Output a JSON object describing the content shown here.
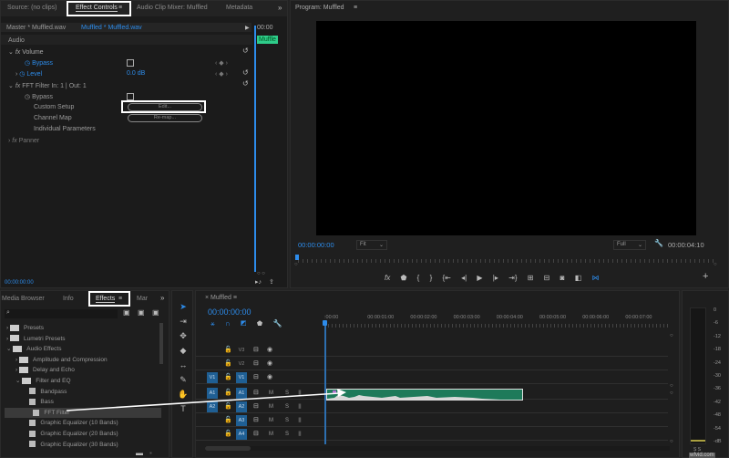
{
  "effect_controls": {
    "tabs": [
      "Source: (no clips)",
      "Effect Controls",
      "Audio Clip Mixer: Muffled",
      "Metadata"
    ],
    "active_tab": "Effect Controls",
    "master": "Master * Muffled.wav",
    "clip": "Muffled * Muffled.wav",
    "mini_timecode": "00:00",
    "mini_clip": "Muffle",
    "section": "Audio",
    "volume": "Volume",
    "bypass": "Bypass",
    "level": "Level",
    "level_value": "0.0",
    "level_unit": "dB",
    "fft": "FFT Filter  In: 1 | Out: 1",
    "custom_setup": "Custom Setup",
    "edit_btn": "Edit...",
    "channel_map": "Channel Map",
    "remap_btn": "Re-map...",
    "individual": "Individual Parameters",
    "panner": "Panner",
    "timecode": "00:00:00:00"
  },
  "program": {
    "title": "Program: Muffled",
    "timecode": "00:00:00:00",
    "fit": "Fit",
    "quality": "Full",
    "duration": "00:00:04:10"
  },
  "effects": {
    "tabs": [
      "Media Browser",
      "Info",
      "Effects",
      "Mar"
    ],
    "active_tab": "Effects",
    "items": [
      {
        "label": "Presets",
        "level": 0,
        "type": "folder-preset",
        "open": false
      },
      {
        "label": "Lumetri Presets",
        "level": 0,
        "type": "folder-preset",
        "open": false
      },
      {
        "label": "Audio Effects",
        "level": 0,
        "type": "folder",
        "open": true
      },
      {
        "label": "Amplitude and Compression",
        "level": 1,
        "type": "folder",
        "open": false
      },
      {
        "label": "Delay and Echo",
        "level": 1,
        "type": "folder",
        "open": false
      },
      {
        "label": "Filter and EQ",
        "level": 1,
        "type": "folder",
        "open": true
      },
      {
        "label": "Bandpass",
        "level": 2,
        "type": "fx"
      },
      {
        "label": "Bass",
        "level": 2,
        "type": "fx"
      },
      {
        "label": "FFT Filter",
        "level": 2,
        "type": "fx",
        "selected": true
      },
      {
        "label": "Graphic Equalizer (10 Bands)",
        "level": 2,
        "type": "fx"
      },
      {
        "label": "Graphic Equalizer (20 Bands)",
        "level": 2,
        "type": "fx"
      },
      {
        "label": "Graphic Equalizer (30 Bands)",
        "level": 2,
        "type": "fx"
      }
    ]
  },
  "timeline": {
    "title": "Muffled",
    "timecode": "00:00:00:00",
    "ruler": [
      ":00:00",
      "00:00:01:00",
      "00:00:02:00",
      "00:00:03:00",
      "00:00:04:00",
      "00:00:05:00",
      "00:00:06:00",
      "00:00:07:00"
    ],
    "video_tracks": [
      {
        "src": "",
        "name": "V3"
      },
      {
        "src": "",
        "name": "V2"
      },
      {
        "src": "V1",
        "name": "V1"
      }
    ],
    "audio_tracks": [
      {
        "src": "A1",
        "name": "A1"
      },
      {
        "src": "A2",
        "name": "A2"
      },
      {
        "src": "",
        "name": "A3"
      },
      {
        "src": "",
        "name": "A4"
      }
    ],
    "m": "M",
    "s": "S",
    "clip_color": "#1e7a5a"
  },
  "meter": {
    "scale": [
      "0",
      "-6",
      "-12",
      "-18",
      "-24",
      "-30",
      "-36",
      "-42",
      "-48",
      "-54",
      "-dB"
    ],
    "solo": [
      "S",
      "S"
    ]
  },
  "watermark": "wfvid.com"
}
